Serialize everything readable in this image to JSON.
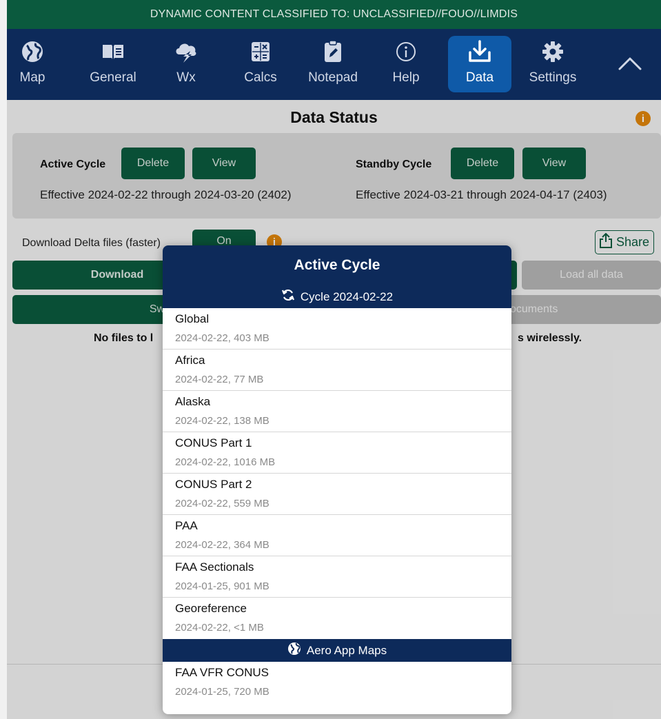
{
  "banner": {
    "text": "DYNAMIC CONTENT CLASSIFIED TO: UNCLASSIFIED//FOUO//LIMDIS"
  },
  "nav": {
    "items": [
      {
        "label": "Map",
        "icon": "globe-icon"
      },
      {
        "label": "General",
        "icon": "book-icon"
      },
      {
        "label": "Wx",
        "icon": "storm-cloud-icon"
      },
      {
        "label": "Calcs",
        "icon": "calculator-icon"
      },
      {
        "label": "Notepad",
        "icon": "notepad-icon"
      },
      {
        "label": "Help",
        "icon": "info-icon"
      },
      {
        "label": "Data",
        "icon": "download-icon",
        "active": true
      },
      {
        "label": "Settings",
        "icon": "gear-icon"
      }
    ],
    "collapse_icon": "chevron-up-icon"
  },
  "data_status": {
    "title": "Data Status",
    "active": {
      "label": "Active Cycle",
      "delete_label": "Delete",
      "view_label": "View",
      "effective": "Effective 2024-02-22 through 2024-03-20 (2402)"
    },
    "standby": {
      "label": "Standby Cycle",
      "delete_label": "Delete",
      "view_label": "View",
      "effective": "Effective 2024-03-21 through 2024-04-17 (2403)"
    }
  },
  "delta": {
    "label": "Download Delta files (faster)",
    "toggle_label": "On"
  },
  "share_label": "Share",
  "actions": {
    "download_label": "Download",
    "load_all_label": "Load all data",
    "swap_label": "Swa",
    "documents_label": "ocuments"
  },
  "no_files": {
    "left": "No files to l",
    "right": "s wirelessly."
  },
  "popover": {
    "title": "Active Cycle",
    "cycle_section": "Cycle 2024-02-22",
    "items": [
      {
        "name": "Global",
        "meta": "2024-02-22, 403 MB"
      },
      {
        "name": "Africa",
        "meta": "2024-02-22, 77 MB"
      },
      {
        "name": "Alaska",
        "meta": "2024-02-22, 138 MB"
      },
      {
        "name": "CONUS Part 1",
        "meta": "2024-02-22, 1016 MB"
      },
      {
        "name": "CONUS Part 2",
        "meta": "2024-02-22, 559 MB"
      },
      {
        "name": "PAA",
        "meta": "2024-02-22, 364 MB"
      },
      {
        "name": "FAA Sectionals",
        "meta": "2024-01-25, 901 MB"
      },
      {
        "name": "Georeference",
        "meta": "2024-02-22, <1 MB"
      }
    ],
    "maps_section": "Aero App Maps",
    "map_items": [
      {
        "name": "FAA VFR CONUS",
        "meta": "2024-01-25, 720 MB"
      }
    ]
  },
  "colors": {
    "navy": "#0d2a5a",
    "green": "#0b5a3e",
    "active_tab": "#0f5aa8",
    "info_orange": "#e0860c"
  }
}
